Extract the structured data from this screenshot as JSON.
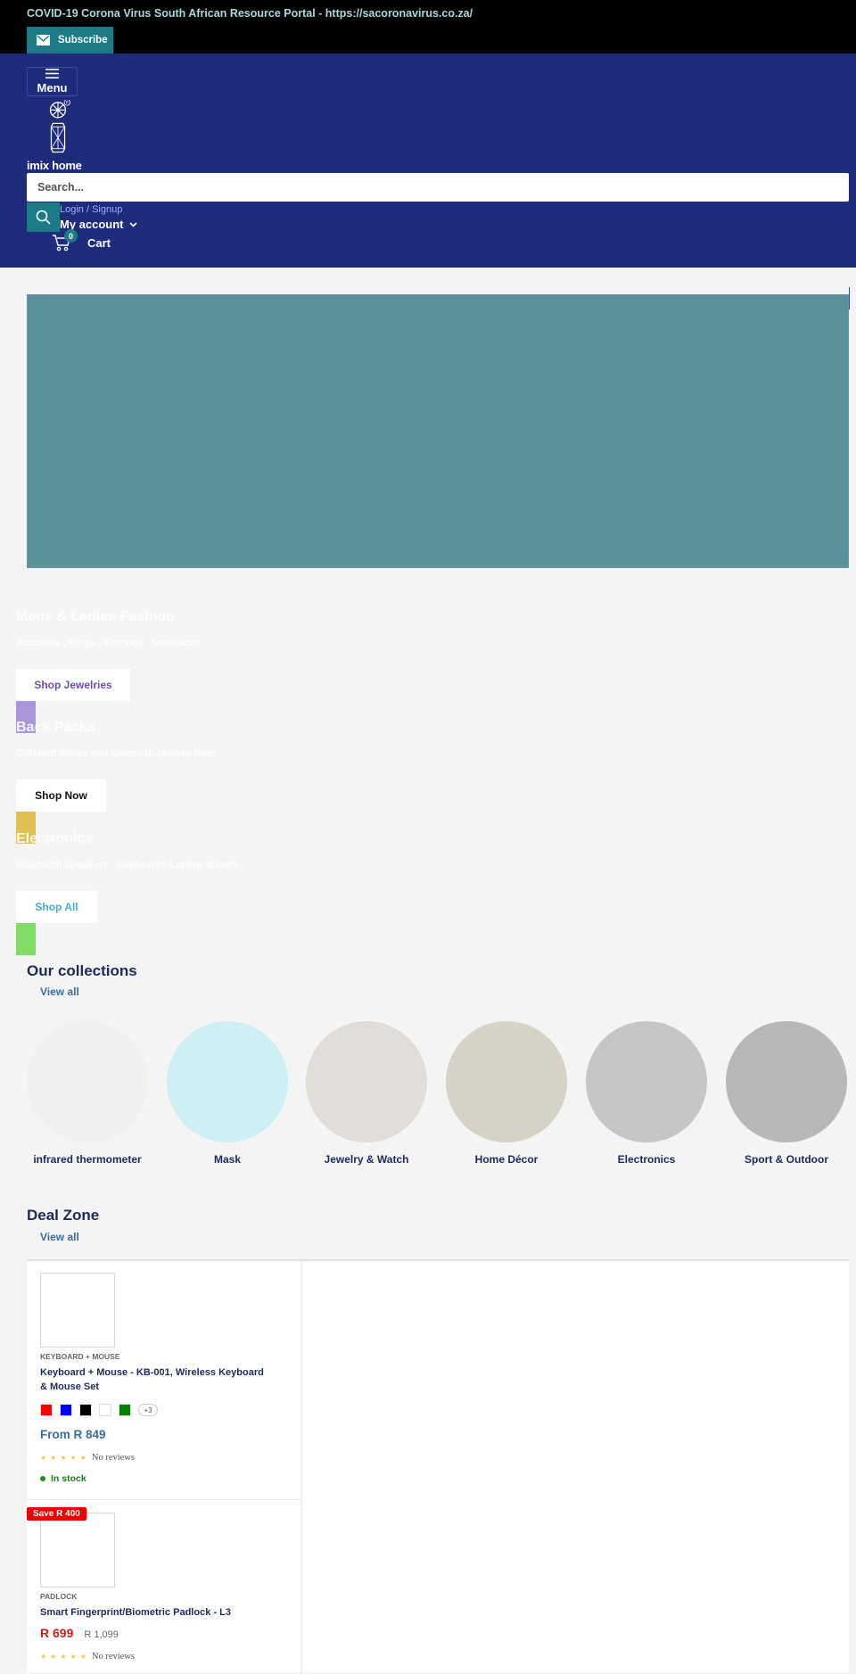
{
  "announcement": {
    "text": "COVID-19 Corona Virus South African Resource Portal - https://sacoronavirus.co.za/",
    "subscribe_label": "Subscribe"
  },
  "header": {
    "menu_label": "Menu",
    "logo_text": "imix home",
    "search_placeholder": "Search...",
    "login_label": "Login / Signup",
    "account_label": "My account",
    "cart_label": "Cart",
    "cart_count": "0"
  },
  "colors": {
    "header_bg": "#1f2b7b",
    "accent_teal": "#1d7a87",
    "hero_bg": "#5a9199",
    "sale_red": "#c8201f"
  },
  "slides": [
    {
      "title": "Mens & Ladies Fashion",
      "subtitle": "Bracelets , Rings , Earrings , Necklaces",
      "button": "Shop Jewelries",
      "button_color": "#6a4fb0",
      "accent": "#a895dc"
    },
    {
      "title": "Back Packs",
      "subtitle": "Different Styles and Colors to choose from",
      "button": "Shop Now",
      "button_color": "#111111",
      "accent": "#e0c050"
    },
    {
      "title": "Electronics",
      "subtitle": "Bluetooth Speakers , Keyboards Laptop Stands",
      "button": "Shop All",
      "button_color": "#3fb2c0",
      "accent": "#7fdc65"
    }
  ],
  "collections": {
    "title": "Our collections",
    "view_all": "View all",
    "items": [
      {
        "label": "infrared thermometer",
        "color": "#eff0ef"
      },
      {
        "label": "Mask",
        "color": "#cdeff3"
      },
      {
        "label": "Jewelry & Watch",
        "color": "#e0ddd8"
      },
      {
        "label": "Home Décor",
        "color": "#d6d2c6"
      },
      {
        "label": "Electronics",
        "color": "#c6c5c6"
      },
      {
        "label": "Sport & Outdoor",
        "color": "#b7b7b7"
      }
    ]
  },
  "deal_zone": {
    "title": "Deal Zone",
    "view_all": "View all",
    "products": [
      {
        "vendor": "KEYBOARD + MOUSE",
        "title": "Keyboard + Mouse - KB-001, Wireless Keyboard & Mouse Set",
        "swatches": [
          "#ff0000",
          "#0000ff",
          "#000000",
          "#ffffff",
          "#008000"
        ],
        "swatch_more": "+3",
        "price": "From R 849",
        "reviews": "No reviews",
        "stars": "★",
        "stock": "In stock"
      },
      {
        "badge": "Save R 400",
        "vendor": "PADLOCK",
        "title": "Smart Fingerprint/Biometric Padlock - L3",
        "price": "R 699",
        "compare_price": "R 1,099",
        "reviews": "No reviews",
        "stars": "★"
      }
    ]
  }
}
